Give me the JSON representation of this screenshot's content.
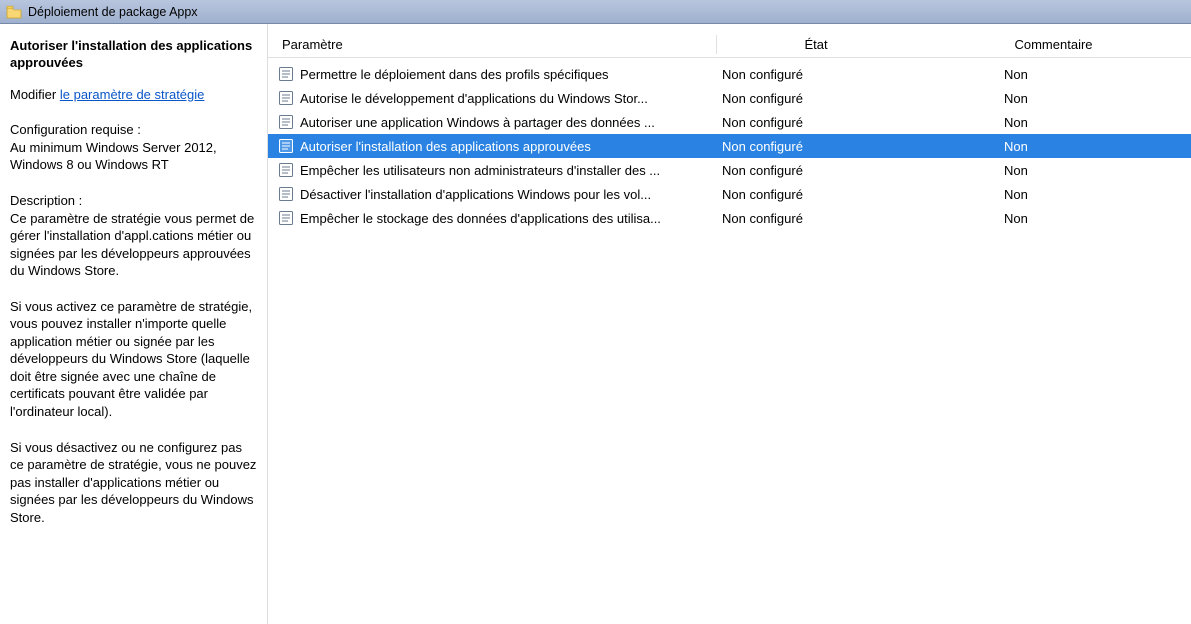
{
  "titlebar": {
    "title": "Déploiement de package Appx"
  },
  "sidepane": {
    "heading": "Autoriser l'installation des applications approuvées",
    "edit_prefix": "Modifier ",
    "edit_link": "le paramètre de stratégie",
    "config_label": "Configuration requise :",
    "config_text": "Au minimum Windows Server 2012, Windows 8 ou Windows RT",
    "desc_label": "Description :",
    "desc_p1": "Ce paramètre de stratégie vous permet de gérer l'installation d'appl.cations métier ou signées par les développeurs approuvées du Windows Store.",
    "desc_p2": "Si vous activez ce paramètre de stratégie, vous pouvez installer n'importe quelle application métier ou signée par les développeurs du Windows Store (laquelle doit être signée avec une chaîne de certificats pouvant être validée par l'ordinateur local).",
    "desc_p3": "Si vous désactivez ou ne configurez pas ce paramètre de stratégie, vous ne pouvez pas installer d'applications métier ou signées par les développeurs du Windows Store."
  },
  "columns": {
    "param": "Paramètre",
    "etat": "État",
    "comm": "Commentaire"
  },
  "rows": [
    {
      "label": "Permettre le déploiement dans des profils spécifiques",
      "etat": "Non configuré",
      "comm": "Non",
      "selected": false
    },
    {
      "label": "Autorise le développement d'applications du Windows Stor...",
      "etat": "Non configuré",
      "comm": "Non",
      "selected": false
    },
    {
      "label": "Autoriser une application Windows à partager des données ...",
      "etat": "Non configuré",
      "comm": "Non",
      "selected": false
    },
    {
      "label": "Autoriser l'installation des applications approuvées",
      "etat": "Non configuré",
      "comm": "Non",
      "selected": true
    },
    {
      "label": "Empêcher les utilisateurs non administrateurs d'installer des ...",
      "etat": "Non configuré",
      "comm": "Non",
      "selected": false
    },
    {
      "label": "Désactiver l'installation d'applications Windows pour les vol...",
      "etat": "Non configuré",
      "comm": "Non",
      "selected": false
    },
    {
      "label": "Empêcher le stockage des données d'applications des utilisa...",
      "etat": "Non configuré",
      "comm": "Non",
      "selected": false
    }
  ]
}
